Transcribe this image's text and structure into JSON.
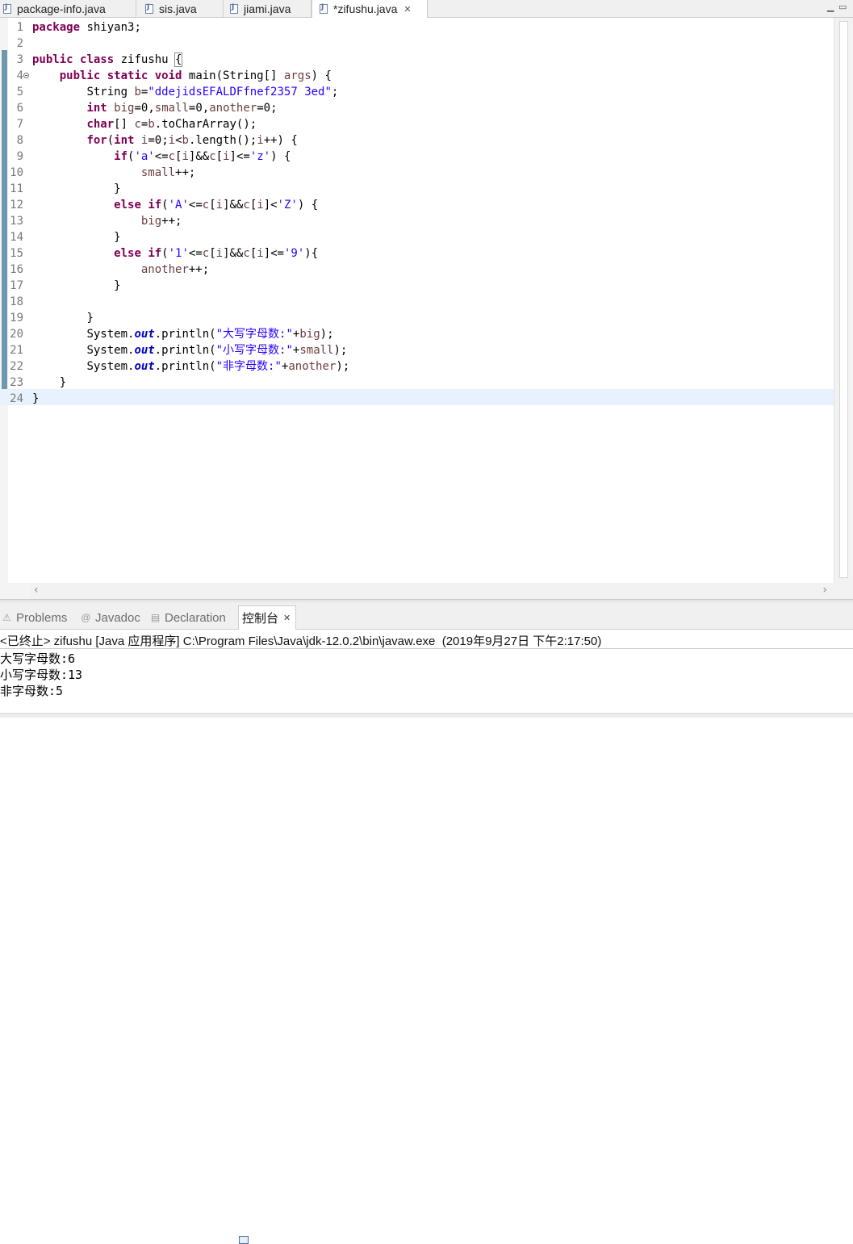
{
  "editor_tabs": [
    {
      "label": "package-info.java"
    },
    {
      "label": "sis.java"
    },
    {
      "label": "jiami.java"
    },
    {
      "label": "*zifushu.java",
      "active": true
    }
  ],
  "code_lines": [
    {
      "n": "1"
    },
    {
      "n": "2"
    },
    {
      "n": "3"
    },
    {
      "n": "4"
    },
    {
      "n": "5"
    },
    {
      "n": "6"
    },
    {
      "n": "7"
    },
    {
      "n": "8"
    },
    {
      "n": "9"
    },
    {
      "n": "10"
    },
    {
      "n": "11"
    },
    {
      "n": "12"
    },
    {
      "n": "13"
    },
    {
      "n": "14"
    },
    {
      "n": "15"
    },
    {
      "n": "16"
    },
    {
      "n": "17"
    },
    {
      "n": "18"
    },
    {
      "n": "19"
    },
    {
      "n": "20"
    },
    {
      "n": "21"
    },
    {
      "n": "22"
    },
    {
      "n": "23"
    },
    {
      "n": "24"
    }
  ],
  "code": {
    "l1_kw": "package",
    "l1_rest": " shiyan3;",
    "l3_kw1": "public",
    "l3_kw2": "class",
    "l3_name": " zifushu ",
    "l3_brace": "{",
    "l4_kw1": "public",
    "l4_kw2": "static",
    "l4_kw3": "void",
    "l4_a": " main(String[] ",
    "l4_var": "args",
    "l4_b": ") {",
    "l5_a": "String ",
    "l5_var": "b",
    "l5_b": "=",
    "l5_str": "\"ddejidsEFALDFfnef2357 3ed\"",
    "l5_c": ";",
    "l6_kw": "int",
    "l6_v1": "big",
    "l6_a": "=0,",
    "l6_v2": "small",
    "l6_b": "=0,",
    "l6_v3": "another",
    "l6_c": "=0;",
    "l7_kw": "char",
    "l7_a": "[] ",
    "l7_v1": "c",
    "l7_b": "=",
    "l7_v2": "b",
    "l7_c": ".toCharArray();",
    "l8_kw1": "for",
    "l8_a": "(",
    "l8_kw2": "int",
    "l8_v1": "i",
    "l8_b": "=0;",
    "l8_v2": "i",
    "l8_c": "<",
    "l8_v3": "b",
    "l8_d": ".length();",
    "l8_v4": "i",
    "l8_e": "++) {",
    "l9_kw": "if",
    "l9_a": "(",
    "l9_s1": "'a'",
    "l9_b": "<=",
    "l9_v1": "c",
    "l9_c": "[",
    "l9_v2": "i",
    "l9_d": "]&&",
    "l9_v3": "c",
    "l9_e": "[",
    "l9_v4": "i",
    "l9_f": "]<=",
    "l9_s2": "'z'",
    "l9_g": ") {",
    "l10_var": "small",
    "l10_a": "++;",
    "l11_a": "}",
    "l12_kw1": "else",
    "l12_kw2": "if",
    "l12_a": "(",
    "l12_s1": "'A'",
    "l12_b": "<=",
    "l12_v1": "c",
    "l12_c": "[",
    "l12_v2": "i",
    "l12_d": "]&&",
    "l12_v3": "c",
    "l12_e": "[",
    "l12_v4": "i",
    "l12_f": "]<",
    "l12_s2": "'Z'",
    "l12_g": ") {",
    "l13_var": "big",
    "l13_a": "++;",
    "l14_a": "}",
    "l15_kw1": "else",
    "l15_kw2": "if",
    "l15_a": "(",
    "l15_s1": "'1'",
    "l15_b": "<=",
    "l15_v1": "c",
    "l15_c": "[",
    "l15_v2": "i",
    "l15_d": "]&&",
    "l15_v3": "c",
    "l15_e": "[",
    "l15_v4": "i",
    "l15_f": "]<=",
    "l15_s2": "'9'",
    "l15_g": "){",
    "l16_var": "another",
    "l16_a": "++;",
    "l17_a": "}",
    "l19_a": "}",
    "l20_a": "System.",
    "l20_f": "out",
    "l20_b": ".println(",
    "l20_s": "\"大写字母数:\"",
    "l20_c": "+",
    "l20_v": "big",
    "l20_d": ");",
    "l21_a": "System.",
    "l21_f": "out",
    "l21_b": ".println(",
    "l21_s": "\"小写字母数:\"",
    "l21_c": "+",
    "l21_v": "small",
    "l21_d": ");",
    "l22_a": "System.",
    "l22_f": "out",
    "l22_b": ".println(",
    "l22_s": "\"非字母数:\"",
    "l22_c": "+",
    "l22_v": "another",
    "l22_d": ");",
    "l23_a": "}",
    "l24_a": "}"
  },
  "view_tabs": {
    "problems": "Problems",
    "javadoc": "Javadoc",
    "declaration": "Declaration",
    "console": "控制台"
  },
  "console": {
    "header": "<已终止> zifushu [Java 应用程序] C:\\Program Files\\Java\\jdk-12.0.2\\bin\\javaw.exe  (2019年9月27日 下午2:17:50)",
    "lines": [
      "大写字母数:6",
      "小写字母数:13",
      "非字母数:5"
    ]
  },
  "icons": {
    "tab_close": "close-icon",
    "minimize": "minimize-icon",
    "maximize": "maximize-icon",
    "scroll_left": "chevron-left-icon",
    "scroll_right": "chevron-right-icon"
  },
  "colors": {
    "keyword": "#7f0055",
    "string": "#2a00ff",
    "local_var": "#6a3e3e",
    "static_field": "#0000c0",
    "current_line": "#e8f2fe"
  }
}
